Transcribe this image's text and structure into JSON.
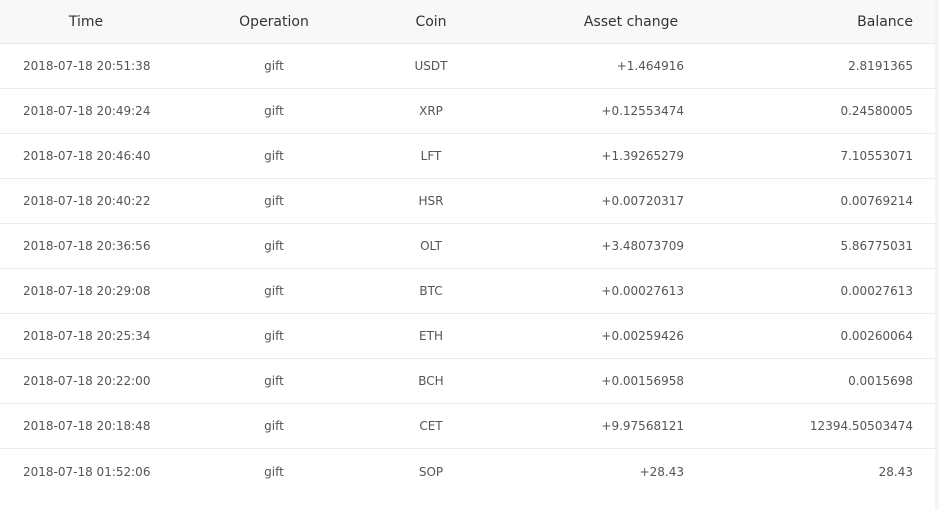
{
  "columns": {
    "time": "Time",
    "operation": "Operation",
    "coin": "Coin",
    "asset_change": "Asset change",
    "balance": "Balance"
  },
  "rows": [
    {
      "time": "2018-07-18 20:51:38",
      "operation": "gift",
      "coin": "USDT",
      "asset_change": "+1.464916",
      "balance": "2.8191365"
    },
    {
      "time": "2018-07-18 20:49:24",
      "operation": "gift",
      "coin": "XRP",
      "asset_change": "+0.12553474",
      "balance": "0.24580005"
    },
    {
      "time": "2018-07-18 20:46:40",
      "operation": "gift",
      "coin": "LFT",
      "asset_change": "+1.39265279",
      "balance": "7.10553071"
    },
    {
      "time": "2018-07-18 20:40:22",
      "operation": "gift",
      "coin": "HSR",
      "asset_change": "+0.00720317",
      "balance": "0.00769214"
    },
    {
      "time": "2018-07-18 20:36:56",
      "operation": "gift",
      "coin": "OLT",
      "asset_change": "+3.48073709",
      "balance": "5.86775031"
    },
    {
      "time": "2018-07-18 20:29:08",
      "operation": "gift",
      "coin": "BTC",
      "asset_change": "+0.00027613",
      "balance": "0.00027613"
    },
    {
      "time": "2018-07-18 20:25:34",
      "operation": "gift",
      "coin": "ETH",
      "asset_change": "+0.00259426",
      "balance": "0.00260064"
    },
    {
      "time": "2018-07-18 20:22:00",
      "operation": "gift",
      "coin": "BCH",
      "asset_change": "+0.00156958",
      "balance": "0.0015698"
    },
    {
      "time": "2018-07-18 20:18:48",
      "operation": "gift",
      "coin": "CET",
      "asset_change": "+9.97568121",
      "balance": "12394.50503474"
    },
    {
      "time": "2018-07-18 01:52:06",
      "operation": "gift",
      "coin": "SOP",
      "asset_change": "+28.43",
      "balance": "28.43"
    }
  ]
}
